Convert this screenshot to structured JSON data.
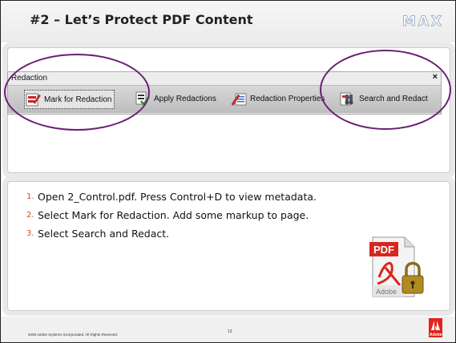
{
  "slide": {
    "title": "#2 – Let’s Protect PDF Content",
    "logo_text": "MAX",
    "toolbar": {
      "title": "Redaction",
      "close_label": "×",
      "buttons": [
        {
          "label": "Mark for Redaction",
          "icon": "mark-redaction-icon"
        },
        {
          "label": "Apply Redactions",
          "icon": "apply-redactions-icon"
        },
        {
          "label": "Redaction Properties",
          "icon": "redaction-properties-icon"
        },
        {
          "label": "Search and Redact",
          "icon": "search-redact-icon"
        }
      ]
    },
    "steps": [
      {
        "num": "1.",
        "text": "Open 2_Control.pdf. Press Control+D to view metadata."
      },
      {
        "num": "2.",
        "text": "Select Mark for Redaction.  Add some markup to page."
      },
      {
        "num": "3.",
        "text": "Select Search and Redact."
      }
    ],
    "pdf_icon": {
      "label": "PDF",
      "brand": "Adobe"
    },
    "footer": {
      "copyright": "2006 Adobe Systems Incorporated.  All Rights Reserved.",
      "page_number": "13",
      "adobe_logo_text": "Adobe"
    },
    "colors": {
      "highlight_circle": "#6a1f74",
      "step_number": "#d84a1b",
      "adobe_red": "#e2231a"
    }
  }
}
